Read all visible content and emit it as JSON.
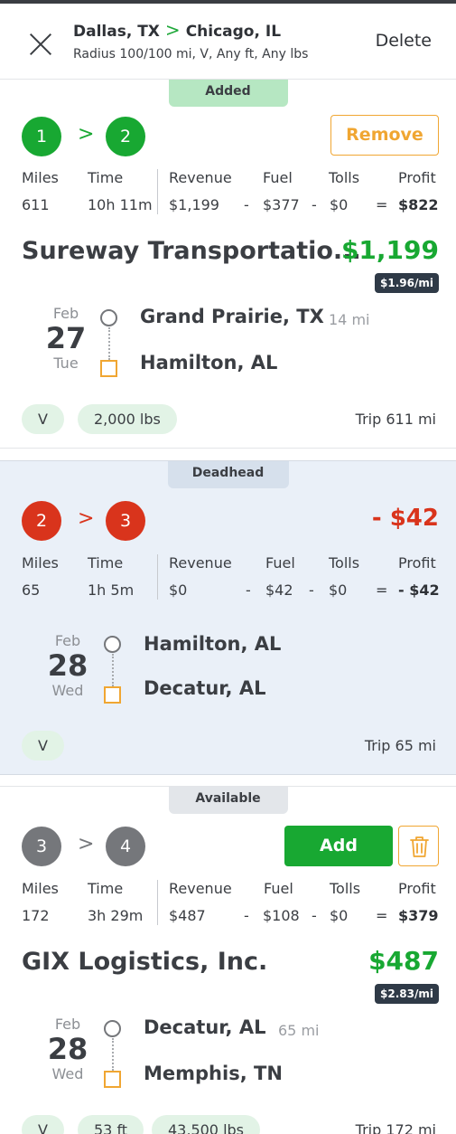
{
  "header": {
    "origin": "Dallas, TX",
    "destination": "Chicago, IL",
    "subtitle": "Radius 100/100 mi, V, Any ft, Any lbs",
    "delete_label": "Delete"
  },
  "stat_labels": {
    "miles": "Miles",
    "time": "Time",
    "revenue": "Revenue",
    "fuel": "Fuel",
    "tolls": "Tolls",
    "profit": "Profit"
  },
  "loads": [
    {
      "tag": "Added",
      "stop_from": "1",
      "stop_to": "2",
      "action_label": "Remove",
      "miles": "611",
      "time": "10h 11m",
      "revenue": "$1,199",
      "fuel": "$377",
      "tolls": "$0",
      "profit": "$822",
      "company": "Sureway Transportatio...",
      "revenue_big": "$1,199",
      "rate_per_mile": "$1.96/mi",
      "month": "Feb",
      "day": "27",
      "weekday": "Tue",
      "origin_city": "Grand Prairie, TX",
      "origin_deadhead": "14 mi",
      "dest_city": "Hamilton, AL",
      "chips": [
        "V",
        "2,000 lbs"
      ],
      "trip": "Trip 611 mi"
    },
    {
      "tag": "Deadhead",
      "stop_from": "2",
      "stop_to": "3",
      "loss": "- $42",
      "miles": "65",
      "time": "1h 5m",
      "revenue": "$0",
      "fuel": "$42",
      "tolls": "$0",
      "profit": "- $42",
      "month": "Feb",
      "day": "28",
      "weekday": "Wed",
      "origin_city": "Hamilton, AL",
      "dest_city": "Decatur, AL",
      "chips": [
        "V"
      ],
      "trip": "Trip 65 mi"
    },
    {
      "tag": "Available",
      "stop_from": "3",
      "stop_to": "4",
      "action_label": "Add",
      "miles": "172",
      "time": "3h 29m",
      "revenue": "$487",
      "fuel": "$108",
      "tolls": "$0",
      "profit": "$379",
      "company": "GIX Logistics, Inc.",
      "revenue_big": "$487",
      "rate_per_mile": "$2.83/mi",
      "month": "Feb",
      "day": "28",
      "weekday": "Wed",
      "origin_city": "Decatur, AL",
      "origin_deadhead": "65 mi",
      "dest_city": "Memphis, TN",
      "chips": [
        "V",
        "53 ft",
        "43,500 lbs"
      ],
      "trip": "Trip 172 mi"
    }
  ],
  "colors": {
    "green": "#18a832",
    "red": "#d9341c",
    "orange": "#f0a632",
    "gray": "#75777b",
    "deadhead_bg": "#eaf0f8"
  },
  "icons": [
    "close-icon",
    "chevron-right-icon",
    "trash-icon"
  ]
}
